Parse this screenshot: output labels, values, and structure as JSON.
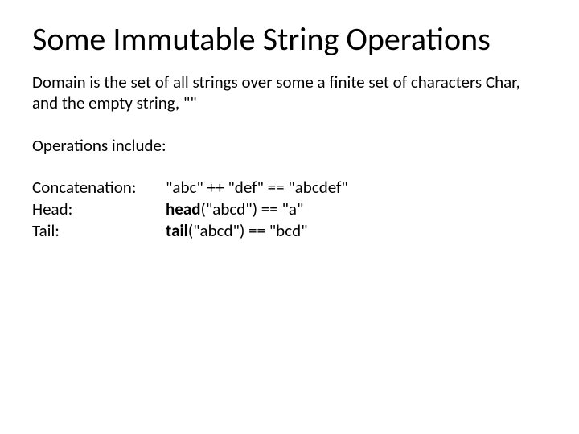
{
  "title": "Some Immutable String Operations",
  "domain_text": "Domain is the set of all strings over some a finite set of characters Char, and the empty string, \"\"",
  "ops_intro": "Operations include:",
  "ops": {
    "concat": {
      "label": "Concatenation:",
      "example": "\"abc\" ++ \"def\" == \"abcdef\""
    },
    "head": {
      "label": "Head:",
      "fn": "head",
      "args_result": "(\"abcd\") == \"a\""
    },
    "tail": {
      "label": "Tail:",
      "fn": "tail",
      "args_result": "(\"abcd\") == \"bcd\""
    }
  }
}
